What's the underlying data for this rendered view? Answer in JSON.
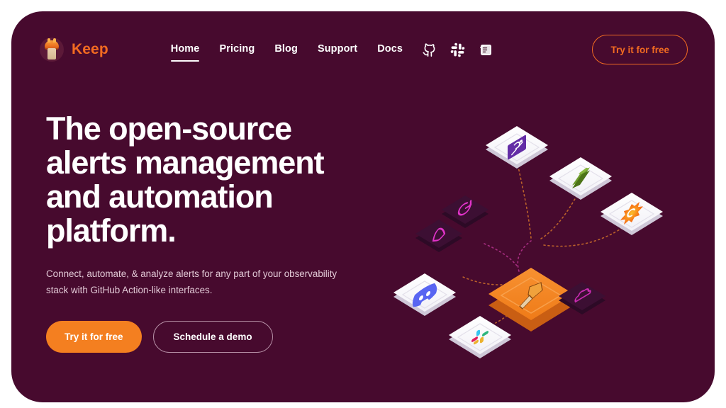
{
  "brand": {
    "name": "Keep",
    "logo_icon": "torch-flame-icon",
    "accent_color": "#f26b21"
  },
  "theme": {
    "card_background": "#470a2e",
    "page_background": "#ffffff",
    "primary_button": "#f47f20",
    "body_text": "#e2c9d6"
  },
  "nav": {
    "links": [
      {
        "label": "Home",
        "active": true
      },
      {
        "label": "Pricing",
        "active": false
      },
      {
        "label": "Blog",
        "active": false
      },
      {
        "label": "Support",
        "active": false
      },
      {
        "label": "Docs",
        "active": false
      }
    ],
    "icons": [
      {
        "name": "github-icon"
      },
      {
        "name": "slack-icon"
      },
      {
        "name": "docs-news-icon"
      }
    ],
    "cta_label": "Try it for free"
  },
  "hero": {
    "title": "The open-source alerts management and automation platform.",
    "subtitle": "Connect, automate, & analyze alerts for any part of your observability stack with GitHub Action-like interfaces.",
    "primary_cta": "Try it for free",
    "secondary_cta": "Schedule a demo"
  },
  "illustration": {
    "hub": {
      "name": "keep-hub-tile",
      "label": "Keep",
      "color": "#f0801f"
    },
    "tiles": [
      {
        "name": "datadog-tile",
        "label": "Datadog",
        "color": "#632ca6",
        "style": "light"
      },
      {
        "name": "green-tool-tile",
        "label": "Green tool",
        "color": "#5c8727",
        "style": "light"
      },
      {
        "name": "grafana-tile",
        "label": "Grafana",
        "color": "#f46800",
        "style": "light"
      },
      {
        "name": "discord-tile",
        "label": "Discord",
        "color": "#5865f2",
        "style": "light"
      },
      {
        "name": "slack-tile",
        "label": "Slack",
        "color": "#e01e5a",
        "style": "light"
      },
      {
        "name": "dim-refresh-tile",
        "label": "Refresh",
        "color": "#e033c8",
        "style": "dark"
      },
      {
        "name": "dim-mongo-tile",
        "label": "Database",
        "color": "#e033c8",
        "style": "dark"
      },
      {
        "name": "dim-cloud-tile",
        "label": "Cloud",
        "color": "#c82bb0",
        "style": "dark"
      }
    ]
  }
}
